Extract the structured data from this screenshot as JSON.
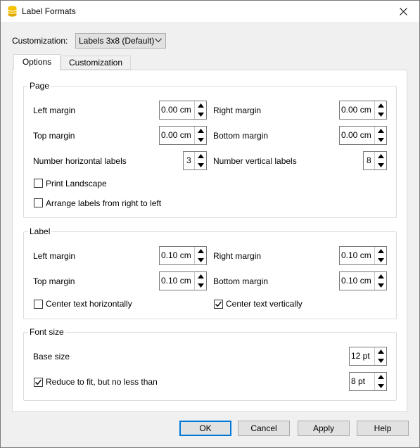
{
  "window": {
    "title": "Label Formats"
  },
  "customization": {
    "label": "Customization:",
    "selected": "Labels 3x8 (Default)"
  },
  "tabs": [
    {
      "label": "Options",
      "active": true
    },
    {
      "label": "Customization",
      "active": false
    }
  ],
  "page": {
    "title": "Page",
    "left_margin": {
      "label": "Left margin",
      "value": "0.00 cm"
    },
    "right_margin": {
      "label": "Right margin",
      "value": "0.00 cm"
    },
    "top_margin": {
      "label": "Top margin",
      "value": "0.00 cm"
    },
    "bottom_margin": {
      "label": "Bottom margin",
      "value": "0.00 cm"
    },
    "num_horizontal": {
      "label": "Number horizontal labels",
      "value": "3"
    },
    "num_vertical": {
      "label": "Number vertical labels",
      "value": "8"
    },
    "print_landscape": {
      "label": "Print Landscape",
      "checked": false
    },
    "right_to_left": {
      "label": "Arrange labels from right to left",
      "checked": false
    }
  },
  "label": {
    "title": "Label",
    "left_margin": {
      "label": "Left margin",
      "value": "0.10 cm"
    },
    "right_margin": {
      "label": "Right margin",
      "value": "0.10 cm"
    },
    "top_margin": {
      "label": "Top margin",
      "value": "0.10 cm"
    },
    "bottom_margin": {
      "label": "Bottom margin",
      "value": "0.10 cm"
    },
    "center_horizontal": {
      "label": "Center text horizontally",
      "checked": false
    },
    "center_vertical": {
      "label": "Center text vertically",
      "checked": true
    }
  },
  "font_size": {
    "title": "Font size",
    "base_size": {
      "label": "Base size",
      "value": "12 pt"
    },
    "reduce_to_fit": {
      "label": "Reduce to fit, but no less than",
      "checked": true,
      "value": "8 pt"
    }
  },
  "buttons": {
    "ok": "OK",
    "cancel": "Cancel",
    "apply": "Apply",
    "help": "Help"
  },
  "colors": {
    "accent": "#0078d7",
    "app_icon": "#f5c000"
  }
}
